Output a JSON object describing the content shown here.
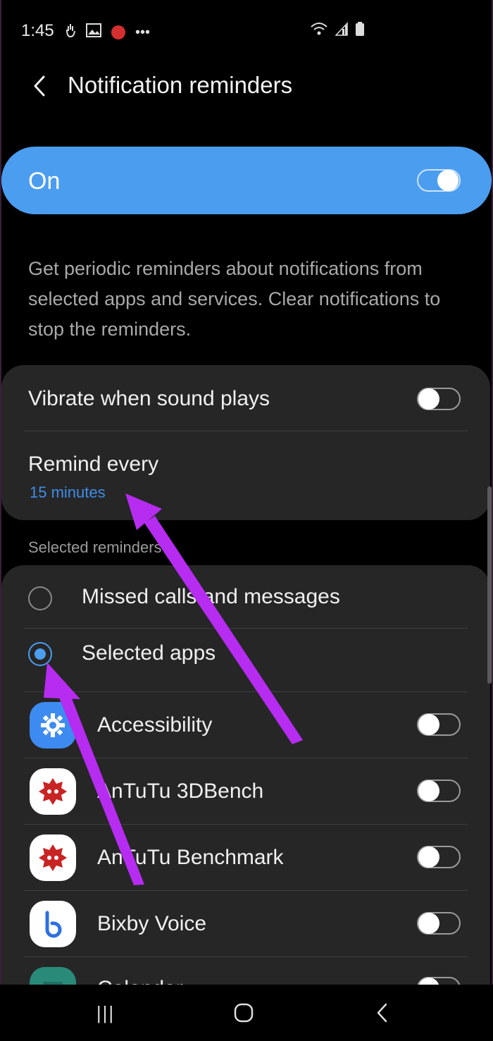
{
  "status_bar": {
    "time": "1:45",
    "more_glyph": "•••",
    "icons": [
      "hand-icon",
      "image-icon",
      "recording-icon",
      "more-icon",
      "wifi-icon",
      "signal-icon",
      "battery-icon"
    ]
  },
  "header": {
    "title": "Notification reminders",
    "back_icon": "back-arrow-icon"
  },
  "master_toggle": {
    "label": "On",
    "state": "on",
    "accent_color": "#4b9df0"
  },
  "description": "Get periodic reminders about notifications from selected apps and services. Clear notifications to stop the reminders.",
  "settings_card": {
    "vibrate": {
      "label": "Vibrate when sound plays",
      "state": "off"
    },
    "remind_every": {
      "label": "Remind every",
      "value": "15 minutes",
      "value_color": "#3e8de8"
    }
  },
  "selected_reminders": {
    "section_label": "Selected reminders",
    "options": [
      {
        "label": "Missed calls and messages",
        "selected": false
      },
      {
        "label": "Selected apps",
        "selected": true
      }
    ],
    "apps": [
      {
        "name": "Accessibility",
        "icon": "gear-icon",
        "state": "off"
      },
      {
        "name": "AnTuTu 3DBench",
        "icon": "antutu-3d-icon",
        "state": "off"
      },
      {
        "name": "AnTuTu Benchmark",
        "icon": "antutu-icon",
        "state": "off"
      },
      {
        "name": "Bixby Voice",
        "icon": "bixby-icon",
        "state": "off"
      },
      {
        "name": "Calendar",
        "icon": "calendar-icon",
        "state": "off"
      }
    ]
  },
  "navbar": {
    "buttons": [
      "recents-icon",
      "home-icon",
      "back-icon"
    ],
    "recents_glyph": "|||"
  },
  "annotation_color": "#b62cf0"
}
